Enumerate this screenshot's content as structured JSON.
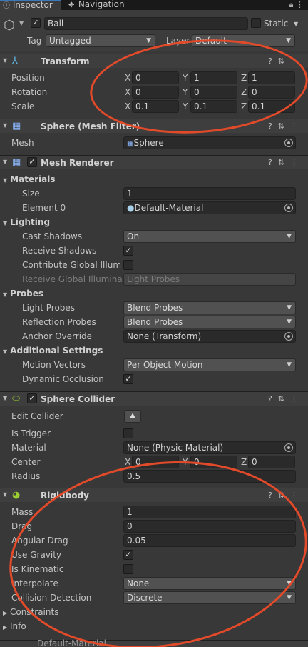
{
  "tabs": {
    "inspector": "Inspector",
    "navigation": "Navigation"
  },
  "object": {
    "name": "Ball",
    "static_label": "Static",
    "tag_label": "Tag",
    "tag_value": "Untagged",
    "layer_label": "Layer",
    "layer_value": "Default"
  },
  "transform": {
    "title": "Transform",
    "position_label": "Position",
    "rotation_label": "Rotation",
    "scale_label": "Scale",
    "x": "X",
    "y": "Y",
    "z": "Z",
    "position": [
      "0",
      "1",
      "1"
    ],
    "rotation": [
      "0",
      "0",
      "0"
    ],
    "scale": [
      "0.1",
      "0.1",
      "0.1"
    ]
  },
  "mesh_filter": {
    "title": "Sphere (Mesh Filter)",
    "mesh_label": "Mesh",
    "mesh_value": "Sphere"
  },
  "mesh_renderer": {
    "title": "Mesh Renderer",
    "materials_label": "Materials",
    "size_label": "Size",
    "size_value": "1",
    "element0_label": "Element 0",
    "element0_value": "Default-Material",
    "lighting_label": "Lighting",
    "cast_shadows_label": "Cast Shadows",
    "cast_shadows_value": "On",
    "receive_shadows_label": "Receive Shadows",
    "contribute_gi_label": "Contribute Global Illumina",
    "receive_gi_label": "Receive Global Illuminati",
    "receive_gi_value": "Light Probes",
    "probes_label": "Probes",
    "light_probes_label": "Light Probes",
    "light_probes_value": "Blend Probes",
    "reflection_probes_label": "Reflection Probes",
    "reflection_probes_value": "Blend Probes",
    "anchor_override_label": "Anchor Override",
    "anchor_override_value": "None (Transform)",
    "additional_label": "Additional Settings",
    "motion_vectors_label": "Motion Vectors",
    "motion_vectors_value": "Per Object Motion",
    "dynamic_occlusion_label": "Dynamic Occlusion"
  },
  "sphere_collider": {
    "title": "Sphere Collider",
    "edit_collider_label": "Edit Collider",
    "is_trigger_label": "Is Trigger",
    "material_label": "Material",
    "material_value": "None (Physic Material)",
    "center_label": "Center",
    "center": [
      "0",
      "0",
      "0"
    ],
    "radius_label": "Radius",
    "radius_value": "0.5"
  },
  "rigidbody": {
    "title": "Rigidbody",
    "mass_label": "Mass",
    "mass_value": "1",
    "drag_label": "Drag",
    "drag_value": "0",
    "angular_drag_label": "Angular Drag",
    "angular_drag_value": "0.05",
    "use_gravity_label": "Use Gravity",
    "is_kinematic_label": "Is Kinematic",
    "interpolate_label": "Interpolate",
    "interpolate_value": "None",
    "collision_detection_label": "Collision Detection",
    "collision_detection_value": "Discrete",
    "constraints_label": "Constraints",
    "info_label": "Info"
  },
  "bottom": {
    "material_label": "Default-Material"
  },
  "colors": {
    "annotation": "#e24a2a",
    "active_tab_accent": "#3a79bb",
    "transform_icon": "#5fb7e8",
    "collider_icon": "#9acd32",
    "rigidbody_icon": "#9acd32"
  }
}
